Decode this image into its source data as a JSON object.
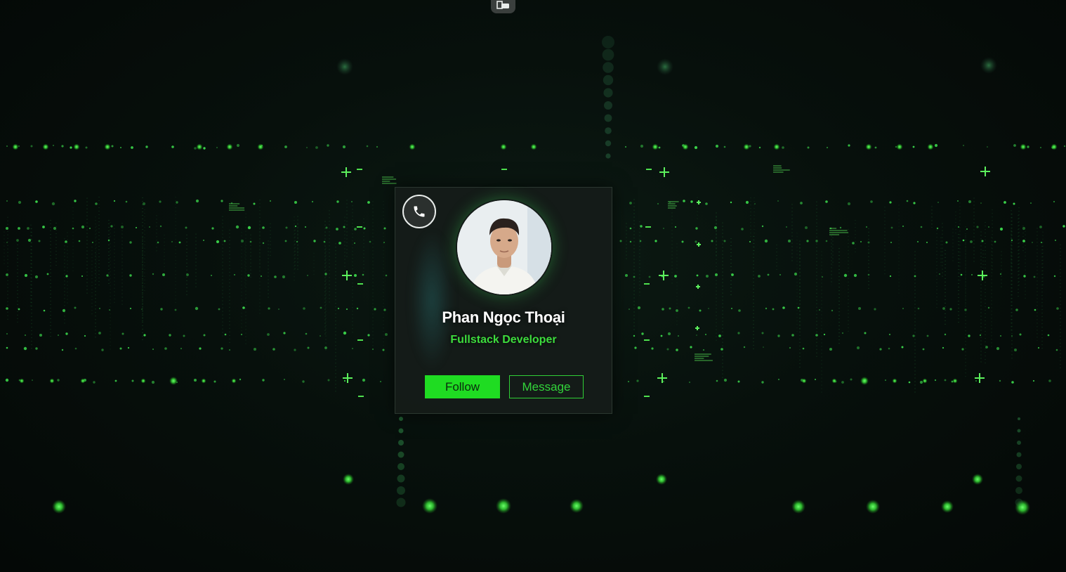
{
  "profile": {
    "name": "Phan Ngọc Thoại",
    "role": "Fullstack Developer"
  },
  "actions": {
    "follow_label": "Follow",
    "message_label": "Message"
  },
  "icons": {
    "call": "phone-icon",
    "top_tab": "picture-in-picture-icon"
  },
  "colors": {
    "accent": "#1fdc22",
    "accent_text": "#3ddc3d",
    "background": "#050a08",
    "card": "#161c19"
  }
}
